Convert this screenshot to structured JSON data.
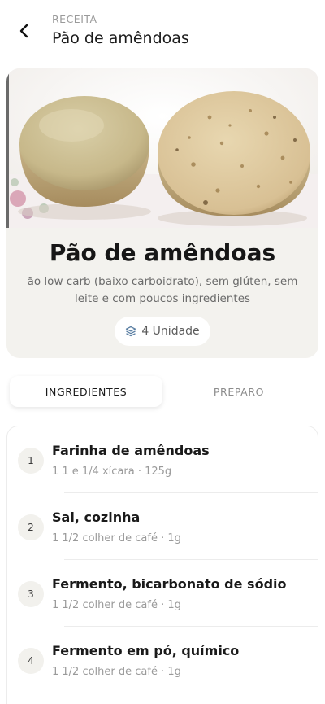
{
  "header": {
    "kicker": "RECEITA",
    "title": "Pão de amêndoas"
  },
  "recipe": {
    "title": "Pão de amêndoas",
    "description": "ão low carb (baixo carboidrato), sem glúten, sem leite e com poucos ingredientes",
    "servings": "4 Unidade",
    "servings_icon": "layers-icon",
    "image_alt": "bread-photo"
  },
  "tabs": {
    "ingredients": "INGREDIENTES",
    "preparation": "PREPARO",
    "active": "ingredients"
  },
  "ingredients": [
    {
      "number": "1",
      "name": "Farinha de amêndoas",
      "quantity": "1 1 e 1/4 xícara · 125g"
    },
    {
      "number": "2",
      "name": "Sal, cozinha",
      "quantity": "1 1/2 colher de café · 1g"
    },
    {
      "number": "3",
      "name": "Fermento, bicarbonato de sódio",
      "quantity": "1 1/2 colher de café · 1g"
    },
    {
      "number": "4",
      "name": "Fermento em pó, químico",
      "quantity": "1 1/2 colher de café · 1g"
    }
  ],
  "colors": {
    "card_bg": "#f3f2ee",
    "accent_text": "#1a1a1a",
    "muted_text": "#9a9a9a",
    "icon_blue": "#5b7fa3"
  }
}
